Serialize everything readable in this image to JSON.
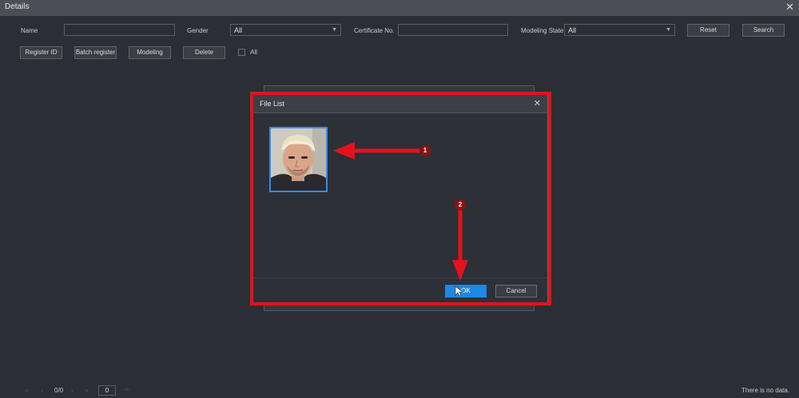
{
  "window": {
    "title": "Details",
    "close_glyph": "✕"
  },
  "filters": {
    "name_label": "Name",
    "name_value": "",
    "gender_label": "Gender",
    "gender_value": "All",
    "certificate_label": "Certificate No.",
    "certificate_value": "",
    "modeling_state_label": "Modeling State",
    "modeling_state_value": "All",
    "reset_label": "Reset",
    "search_label": "Search"
  },
  "toolbar": {
    "register_id_label": "Register ID",
    "batch_register_label": "Batch register",
    "modeling_label": "Modeling",
    "delete_label": "Delete",
    "all_label": "All"
  },
  "dialog": {
    "title": "File List",
    "close_glyph": "✕",
    "ok_label": "OK",
    "cancel_label": "Cancel"
  },
  "annotations": {
    "badge_1": "1",
    "badge_2": "2",
    "accent_color": "#e3131b"
  },
  "pagination": {
    "first_glyph": "«",
    "prev_glyph": "‹",
    "page_info": "0/0",
    "next_glyph": "›",
    "last_glyph": "»",
    "page_input": "0",
    "go_glyph": "⇒",
    "empty_text": "There is no data."
  },
  "colors": {
    "background": "#2b2e35",
    "primary": "#1e88e5",
    "selection": "#2f8ef0"
  }
}
